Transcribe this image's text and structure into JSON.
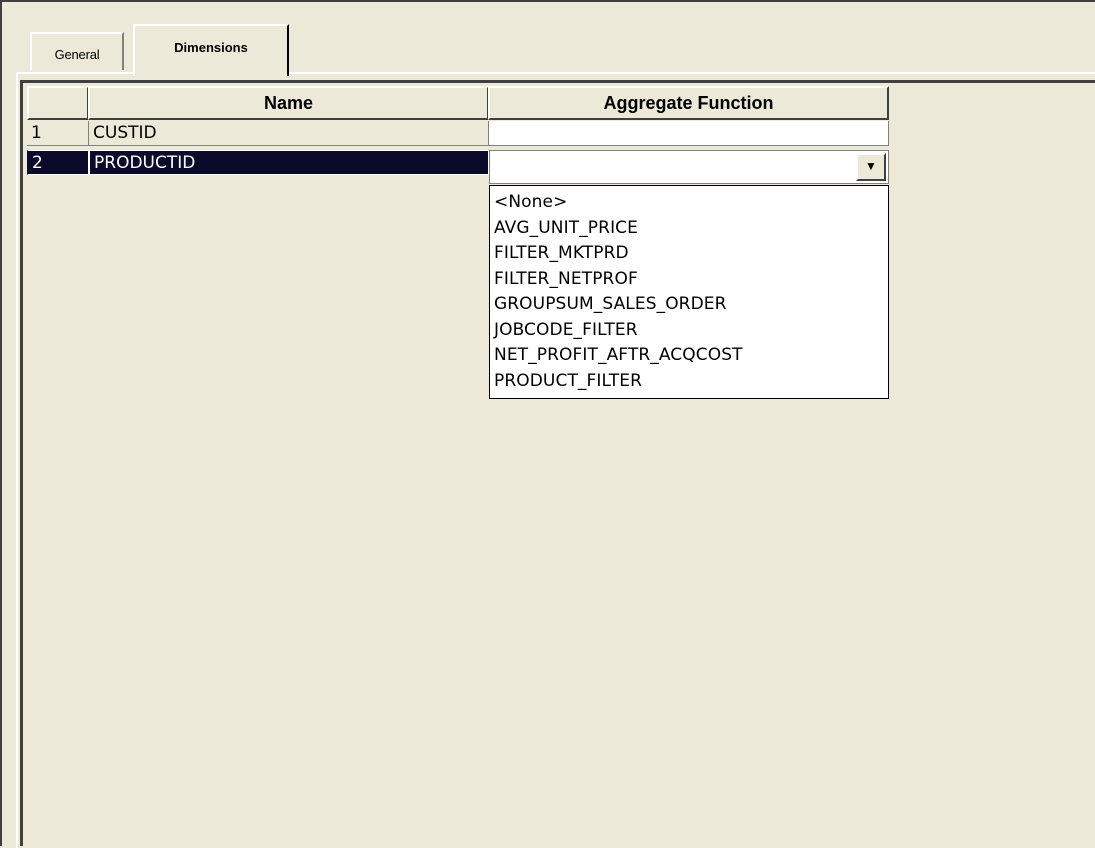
{
  "tabs": [
    {
      "label": "General"
    },
    {
      "label": "Dimensions"
    }
  ],
  "grid": {
    "columns": [
      "",
      "Name",
      "Aggregate Function"
    ],
    "rows": [
      {
        "num": "1",
        "name": "CUSTID",
        "agg": ""
      },
      {
        "num": "2",
        "name": "PRODUCTID",
        "agg": ""
      }
    ]
  },
  "dropdown": {
    "arrow": "▼",
    "options": [
      "<None>",
      "AVG_UNIT_PRICE",
      "FILTER_MKTPRD",
      "FILTER_NETPROF",
      "GROUPSUM_SALES_ORDER",
      "JOBCODE_FILTER",
      "NET_PROFIT_AFTR_ACQCOST",
      "PRODUCT_FILTER"
    ]
  }
}
